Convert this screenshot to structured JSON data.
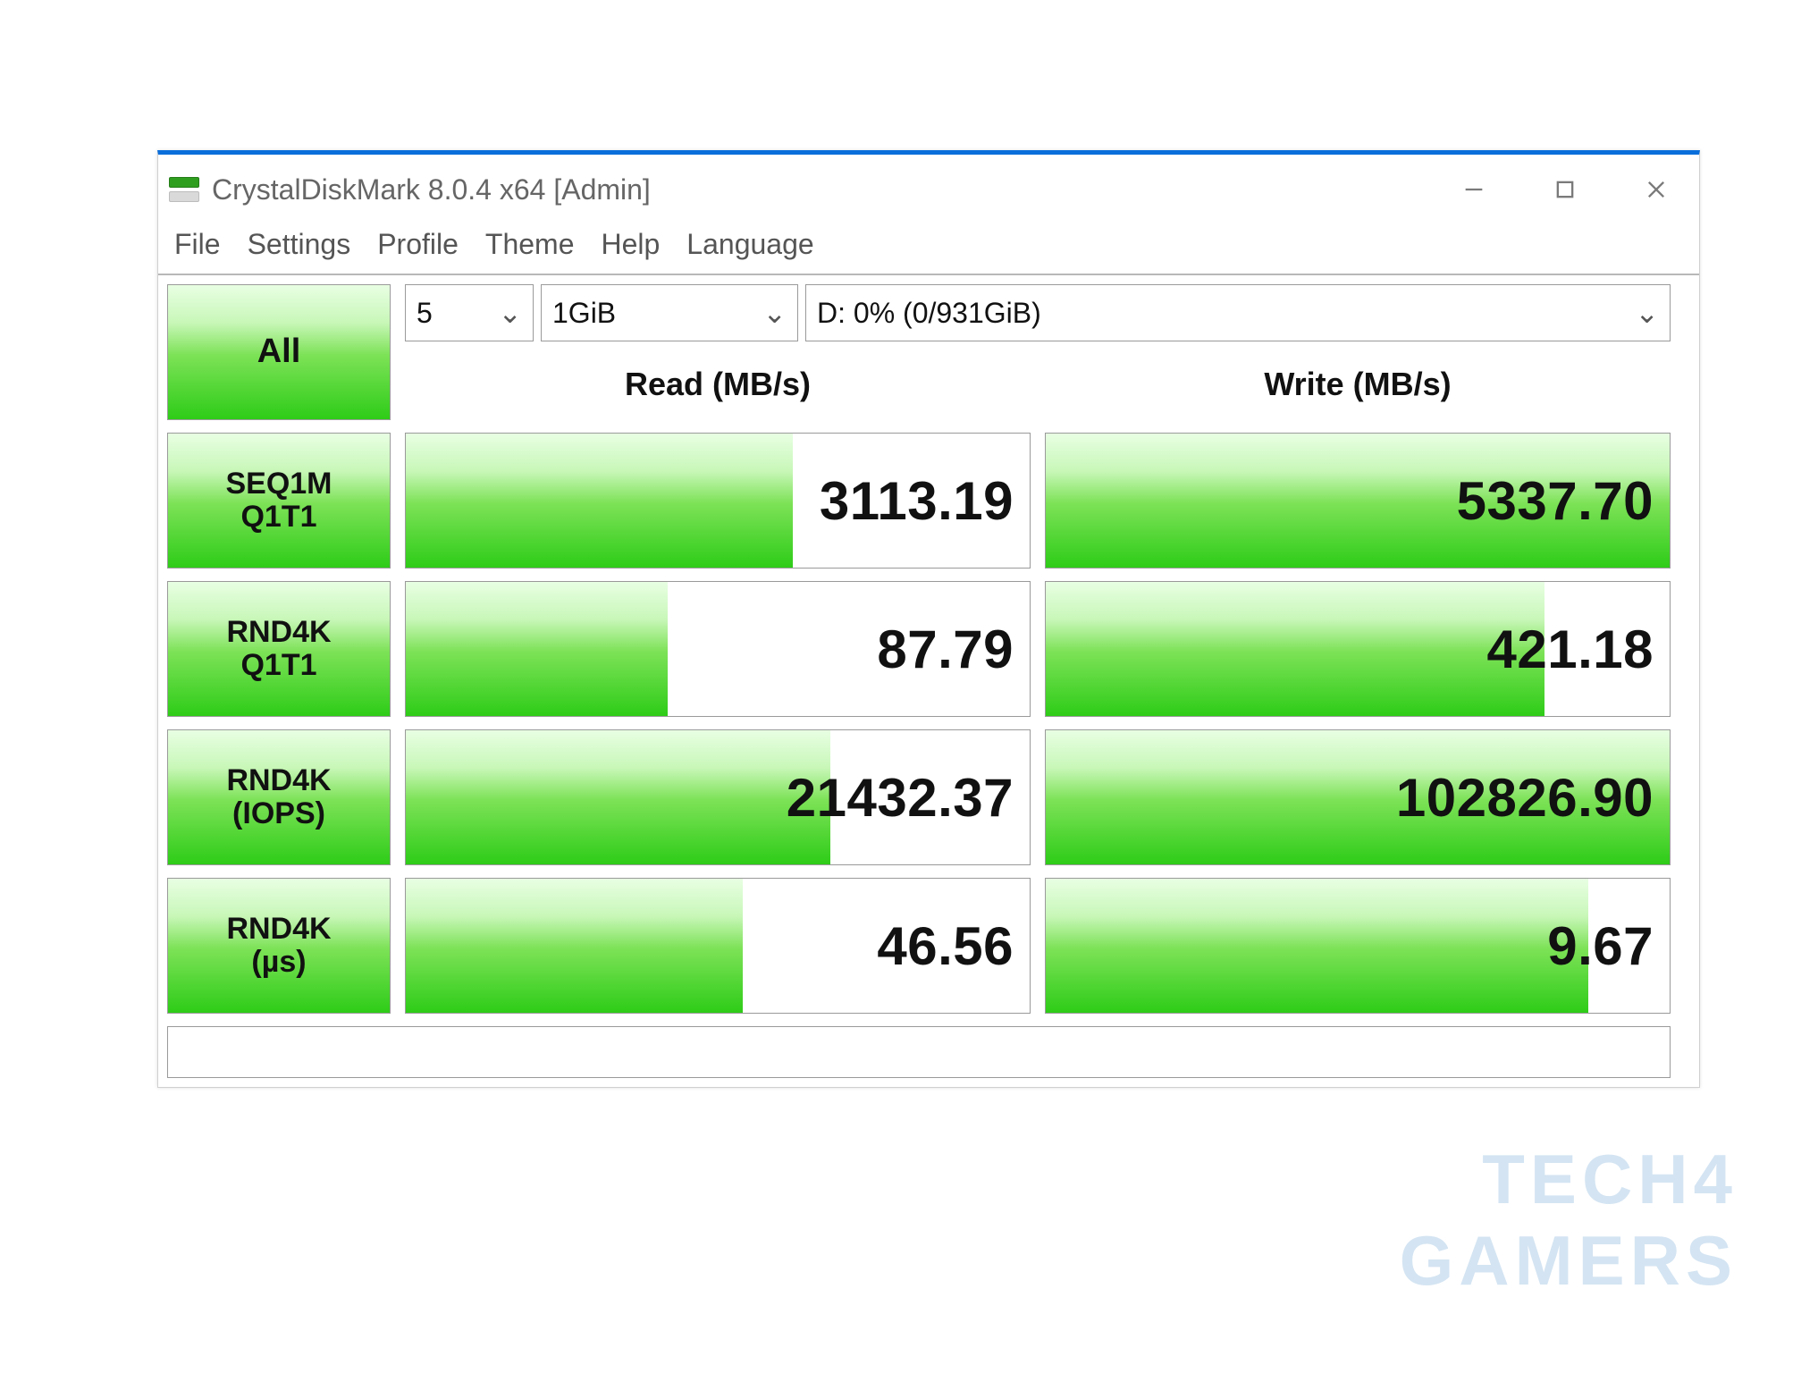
{
  "window": {
    "title": "CrystalDiskMark 8.0.4 x64 [Admin]"
  },
  "menu": {
    "items": [
      "File",
      "Settings",
      "Profile",
      "Theme",
      "Help",
      "Language"
    ]
  },
  "controls": {
    "all_button": "All",
    "run_count": "5",
    "test_size": "1GiB",
    "drive": "D: 0% (0/931GiB)"
  },
  "headers": {
    "read": "Read (MB/s)",
    "write": "Write (MB/s)"
  },
  "rows": [
    {
      "label_line1": "SEQ1M",
      "label_line2": "Q1T1",
      "read": "3113.19",
      "read_fill": 62,
      "write": "5337.70",
      "write_fill": 100
    },
    {
      "label_line1": "RND4K",
      "label_line2": "Q1T1",
      "read": "87.79",
      "read_fill": 42,
      "write": "421.18",
      "write_fill": 80
    },
    {
      "label_line1": "RND4K",
      "label_line2": "(IOPS)",
      "read": "21432.37",
      "read_fill": 68,
      "write": "102826.90",
      "write_fill": 100
    },
    {
      "label_line1": "RND4K",
      "label_line2": "(µs)",
      "read": "46.56",
      "read_fill": 54,
      "write": "9.67",
      "write_fill": 87
    }
  ],
  "status_text": "",
  "watermark": {
    "line1": "TECH4",
    "line2": "GAMERS"
  }
}
